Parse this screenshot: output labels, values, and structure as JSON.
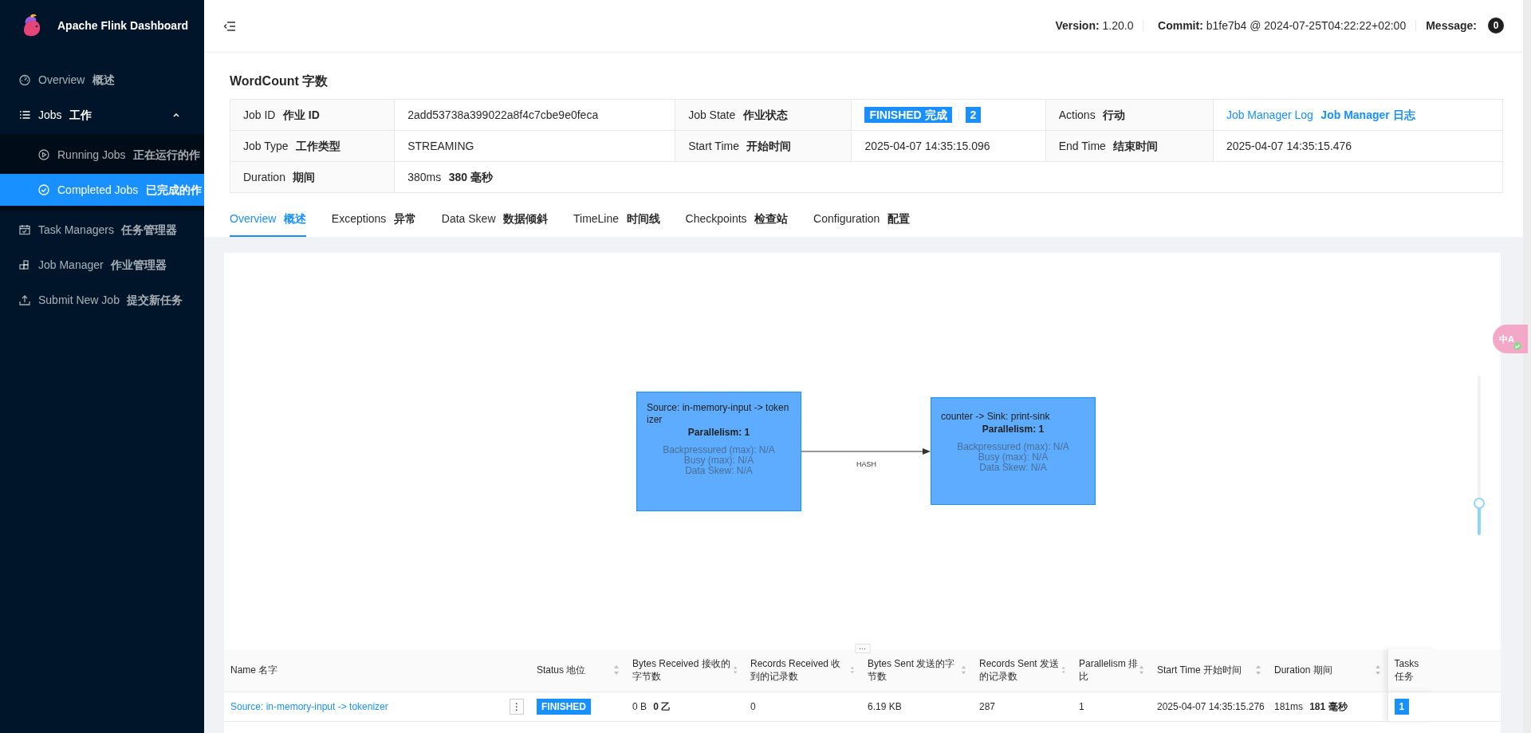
{
  "sidebar": {
    "title": "Apache Flink Dashboard",
    "items": [
      {
        "label": "Overview **概述**",
        "selected": false
      },
      {
        "label": "Jobs **工作**",
        "selected": false,
        "expanded": true,
        "children": [
          {
            "label": "Running Jobs **正在运行的作**",
            "selected": false
          },
          {
            "label": "Completed Jobs **已完成的作**",
            "selected": true
          }
        ]
      },
      {
        "label": "Task Managers **任务管理器**",
        "selected": false
      },
      {
        "label": "Job Manager **作业管理器**",
        "selected": false
      },
      {
        "label": "Submit New Job **提交新任务**",
        "selected": false
      }
    ]
  },
  "header": {
    "version": "**Version:** 1.20.0",
    "commit": "**Commit:** b1fe7b4 @ 2024-07-25T04:22:22+02:00",
    "message_label": "Message:",
    "message_count": "0"
  },
  "job": {
    "title": "WordCount 字数",
    "details": [
      {
        "kind": "text",
        "label": "Job ID **作业 ID**",
        "value": "2add53738a399022a8f4c7cbe9e0feca"
      },
      {
        "kind": "status",
        "label": "Job State **作业状态**",
        "value": "FINISHED 完成",
        "count": "2"
      },
      {
        "kind": "link",
        "label": "Actions **行动**",
        "value": "Job Manager Log **Job Manager 日志**"
      },
      {
        "kind": "text",
        "label": "Job Type **工作类型**",
        "value": "STREAMING"
      },
      {
        "kind": "text",
        "label": "Start Time **开始时间**",
        "value": "2025-04-07 14:35:15.096"
      },
      {
        "kind": "text",
        "label": "End Time **结束时间**",
        "value": "2025-04-07 14:35:15.476"
      },
      {
        "kind": "text",
        "label": "Duration **期间**",
        "value": "380ms **380 毫秒**"
      }
    ]
  },
  "tabs": [
    {
      "label": "Overview **概述**",
      "selected": true
    },
    {
      "label": "Exceptions **异常**",
      "selected": false
    },
    {
      "label": "Data Skew **数据倾斜**",
      "selected": false
    },
    {
      "label": "TimeLine **时间线**",
      "selected": false
    },
    {
      "label": "Checkpoints **检查站**",
      "selected": false
    },
    {
      "label": "Configuration **配置**",
      "selected": false
    }
  ],
  "graph": {
    "nodes": [
      {
        "title": "Source: in-memory-input -> tokenizer",
        "parallelism": "Parallelism: 1",
        "stats": [
          "Backpressured (max): N/A",
          "Busy (max): N/A",
          "Data Skew: N/A"
        ]
      },
      {
        "title": "counter -> Sink: print-sink",
        "parallelism": "Parallelism: 1",
        "stats": [
          "Backpressured (max): N/A",
          "Busy (max): N/A",
          "Data Skew: N/A"
        ]
      }
    ],
    "edges": [
      {
        "label": "HASH"
      }
    ],
    "zoom_slider": {
      "level": 0.2
    }
  },
  "resize_handle": "···",
  "table": {
    "columns": [
      {
        "label": "Name 名字",
        "sortable": false
      },
      {
        "label": "Status 地位",
        "sortable": true
      },
      {
        "label": "Bytes Received 接收的字节数",
        "sortable": true
      },
      {
        "label": "Records Received 收到的记录数",
        "sortable": true
      },
      {
        "label": "Bytes Sent 发送的字节数",
        "sortable": true
      },
      {
        "label": "Records Sent 发送的记录数",
        "sortable": true
      },
      {
        "label": "Parallelism 排比",
        "sortable": true
      },
      {
        "label": "Start Time 开始时间",
        "sortable": true
      },
      {
        "label": "Duration 期间",
        "sortable": true
      },
      {
        "label": "Tasks 任务",
        "sortable": false
      }
    ],
    "rows": [
      {
        "name": "Source: in-memory-input -> tokenizer",
        "menu": "⋮",
        "status": "FINISHED",
        "bytes_received": "0 B **0 乙**",
        "records_received": "0",
        "bytes_sent": "6.19 KB",
        "records_sent": "287",
        "parallelism": "1",
        "start_time": "2025-04-07 14:35:15.276",
        "duration": "181ms **181 毫秒**",
        "tasks": "1"
      }
    ]
  },
  "translate_widget": "中A"
}
